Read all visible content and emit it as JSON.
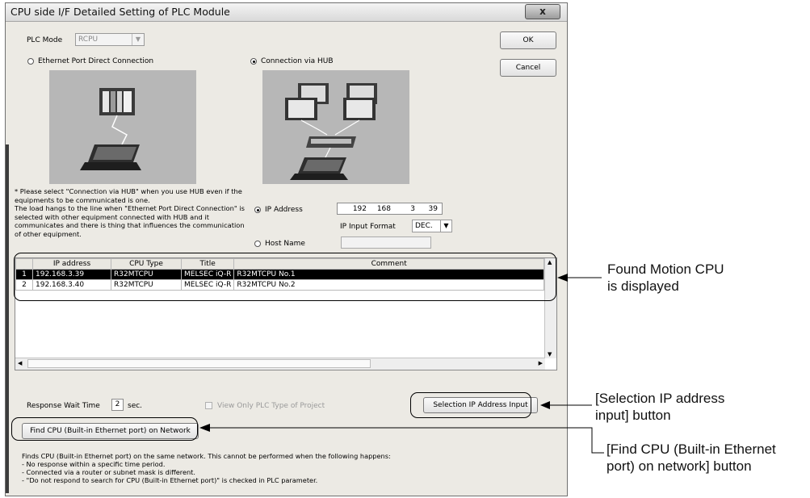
{
  "window": {
    "title": "CPU side I/F Detailed Setting of PLC Module",
    "close_label": "x"
  },
  "plc_mode": {
    "label": "PLC Mode",
    "value": "RCPU"
  },
  "buttons": {
    "ok": "OK",
    "cancel": "Cancel",
    "selection_ip": "Selection IP Address Input",
    "find_cpu": "Find CPU (Built-in Ethernet port) on Network"
  },
  "connection": {
    "direct_label": "Ethernet Port Direct Connection",
    "hub_label": "Connection via HUB",
    "selected": "hub"
  },
  "note_text": "* Please select \"Connection via HUB\" when you use HUB even if the equipments to be communicated is one.\nThe load hangs to the line when \"Ethernet Port Direct Connection\" is selected with other equipment connected with HUB and it communicates and there is thing that influences the communication of other equipment.",
  "address": {
    "ip_label": "IP Address",
    "ip_octets": [
      "192",
      "168",
      "3",
      "39"
    ],
    "ip_input_format_label": "IP Input Format",
    "ip_input_format_value": "DEC.",
    "host_label": "Host Name",
    "host_value": ""
  },
  "table": {
    "headers": [
      "IP address",
      "CPU Type",
      "Title",
      "Comment"
    ],
    "rows": [
      {
        "num": "1",
        "ip": "192.168.3.39",
        "cpu_type": "R32MTCPU",
        "title": "MELSEC iQ-R",
        "comment": "R32MTCPU No.1"
      },
      {
        "num": "2",
        "ip": "192.168.3.40",
        "cpu_type": "R32MTCPU",
        "title": "MELSEC iQ-R",
        "comment": "R32MTCPU No.2"
      }
    ]
  },
  "response": {
    "label": "Response Wait Time",
    "value": "2",
    "unit": "sec."
  },
  "view_only_label": "View Only PLC Type of Project",
  "find_info": "Finds CPU (Built-in Ethernet port) on the same network. This cannot be performed when the following happens:\n- No response within a specific time period.\n- Connected via a router or subnet mask is different.\n- \"Do not respond to search for CPU (Built-in Ethernet port)\" is checked in PLC parameter.",
  "callouts": {
    "found": "Found Motion CPU\nis displayed",
    "selection": "[Selection IP address\ninput] button",
    "find": "[Find CPU (Built-in Ethernet\nport) on network] button"
  },
  "colors": {
    "dialog_bg": "#eceae4",
    "selected_row_bg": "#000000",
    "picture_bg": "#b7b7b7"
  }
}
